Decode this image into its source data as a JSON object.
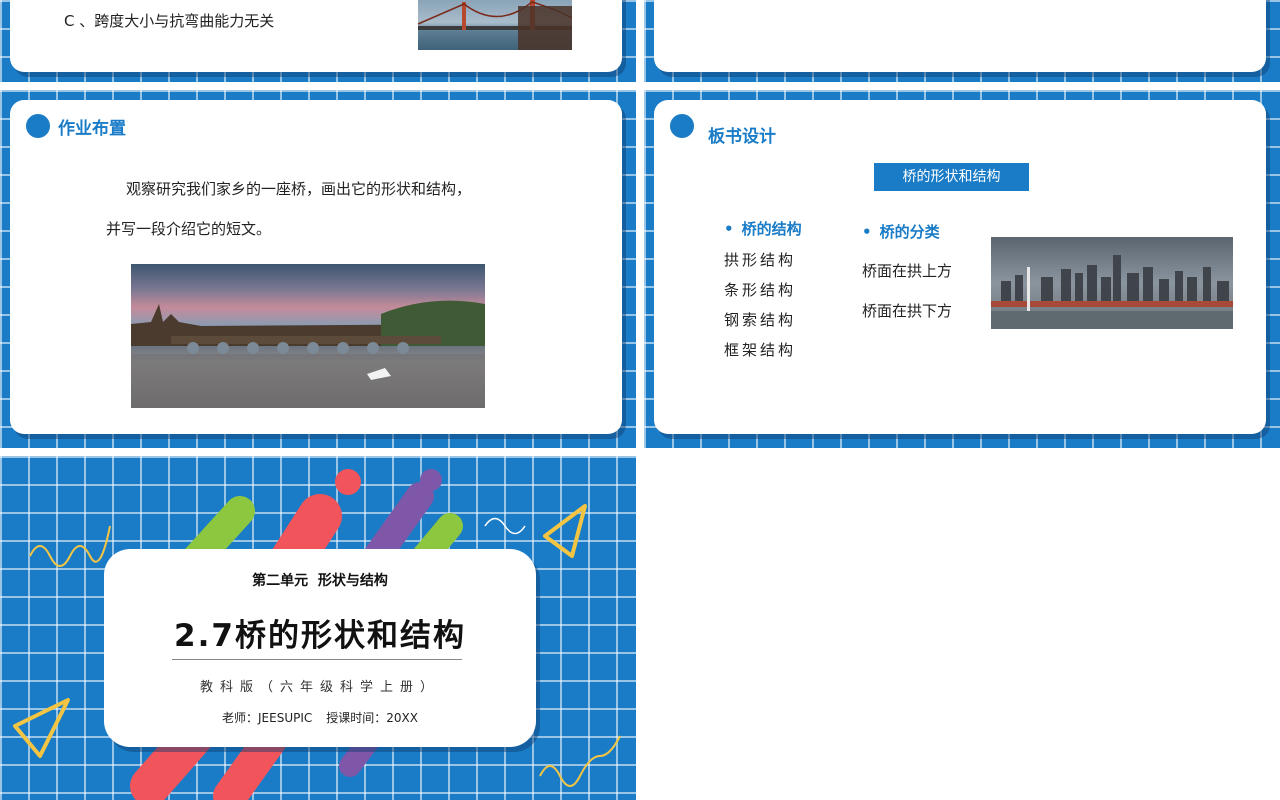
{
  "colors": {
    "primary": "#1a7cc7",
    "card": "#ffffff",
    "text": "#222222"
  },
  "slide_quiz": {
    "option_c": "C 、跨度大小与抗弯曲能力无关",
    "image": "suspension-bridge-photo"
  },
  "slide_homework": {
    "heading": "作业布置",
    "line1": "观察研究我们家乡的一座桥，画出它的形状和结构，",
    "line2": "并写一段介绍它的短文。",
    "image": "stone-arch-bridge-river-photo"
  },
  "slide_board": {
    "heading": "板书设计",
    "banner": "桥的形状和结构",
    "col1": {
      "title": "桥的结构",
      "items": [
        "拱形结构",
        "条形结构",
        "钢索结构",
        "框架结构"
      ]
    },
    "col2": {
      "title": "桥的分类",
      "items": [
        "桥面在拱上方",
        "桥面在拱下方"
      ]
    },
    "bullet_glyph": "•",
    "image": "city-skyline-bridge-photo"
  },
  "slide_cover": {
    "unit": "第二单元  形状与结构",
    "title": "2.7桥的形状和结构",
    "edition": "教科版（六年级科学上册）",
    "teacher": "老师：JEESUPIC",
    "time": "授课时间：20XX"
  }
}
